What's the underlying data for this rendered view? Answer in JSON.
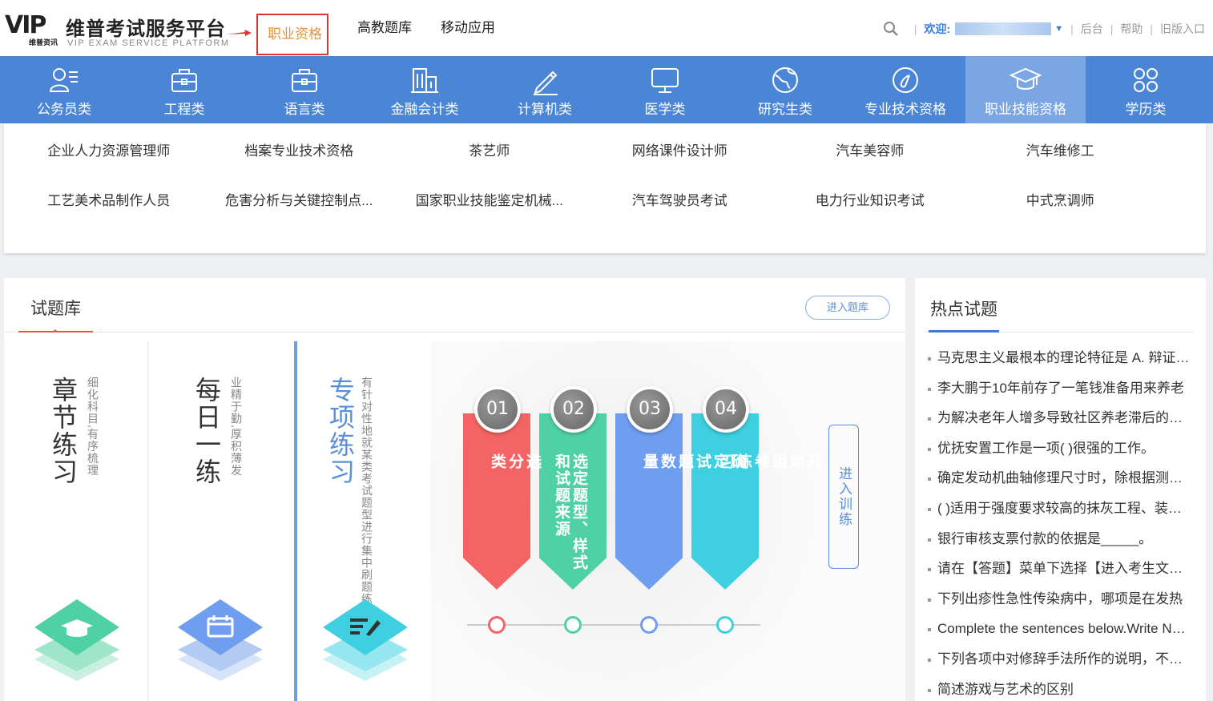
{
  "logo": {
    "vip": "VIP",
    "cn": "维普考试服务平台",
    "sub": "维普资讯",
    "en": "VIP EXAM SERVICE PLATFORM"
  },
  "topnav": [
    "职业资格",
    "高教题库",
    "移动应用"
  ],
  "topright": {
    "welcome": "欢迎:",
    "links": [
      "后台",
      "帮助",
      "旧版入口"
    ]
  },
  "categories": [
    {
      "label": "公务员类",
      "icon": "person-list-icon"
    },
    {
      "label": "工程类",
      "icon": "briefcase-icon"
    },
    {
      "label": "语言类",
      "icon": "briefcase-icon"
    },
    {
      "label": "金融会计类",
      "icon": "building-icon"
    },
    {
      "label": "计算机类",
      "icon": "pen-icon"
    },
    {
      "label": "医学类",
      "icon": "monitor-icon"
    },
    {
      "label": "研究生类",
      "icon": "globe-icon"
    },
    {
      "label": "专业技术资格",
      "icon": "at-icon"
    },
    {
      "label": "职业技能资格",
      "icon": "graduation-cap-icon"
    },
    {
      "label": "学历类",
      "icon": "grid-circles-icon"
    }
  ],
  "subcategories": [
    "企业人力资源管理师",
    "档案专业技术资格",
    "茶艺师",
    "网络课件设计师",
    "汽车美容师",
    "汽车维修工",
    "工艺美术品制作人员",
    "危害分析与关键控制点...",
    "国家职业技能鉴定机械...",
    "汽车驾驶员考试",
    "电力行业知识考试",
    "中式烹调师"
  ],
  "bank": {
    "title": "试题库",
    "enter": "进入题库",
    "modes": [
      {
        "title": "章节练习",
        "desc": "细化科目,有序梳理"
      },
      {
        "title": "每日一练",
        "desc": "业精于勤,厚积薄发"
      },
      {
        "title": "专项练习",
        "desc": "有针对性地就某类考试题型进行集中刷题练习"
      }
    ],
    "steps": [
      {
        "num": "01",
        "text": "选分类",
        "color": "#f56464"
      },
      {
        "num": "02",
        "text": "选定题型、样式和试题来源",
        "color": "#4fd1a5"
      },
      {
        "num": "03",
        "text": "确定试题数量",
        "color": "#6f9ef0"
      },
      {
        "num": "04",
        "text": "开始组卷练习",
        "color": "#3ed0e0"
      }
    ],
    "train": "进入训练"
  },
  "hot": {
    "title": "热点试题",
    "items": [
      "马克思主义最根本的理论特征是 A. 辩证唯物主义",
      "李大鹏于10年前存了一笔钱准备用来养老",
      "为解决老年人增多导致社区养老滞后的问题",
      "优抚安置工作是一项( )很强的工作。",
      "确定发动机曲轴修理尺寸时，除根据测量结果",
      "( )适用于强度要求较高的抹灰工程、装饰工程",
      "银行审核支票付款的依据是_____。",
      "请在【答题】菜单下选择【进入考生文件夹】",
      "下列出疹性急性传染病中，哪项是在发热",
      "Complete the sentences below.Write NO MORE",
      "下列各项中对修辞手法所作的说明，不正确的",
      "简述游戏与艺术的区别"
    ]
  }
}
